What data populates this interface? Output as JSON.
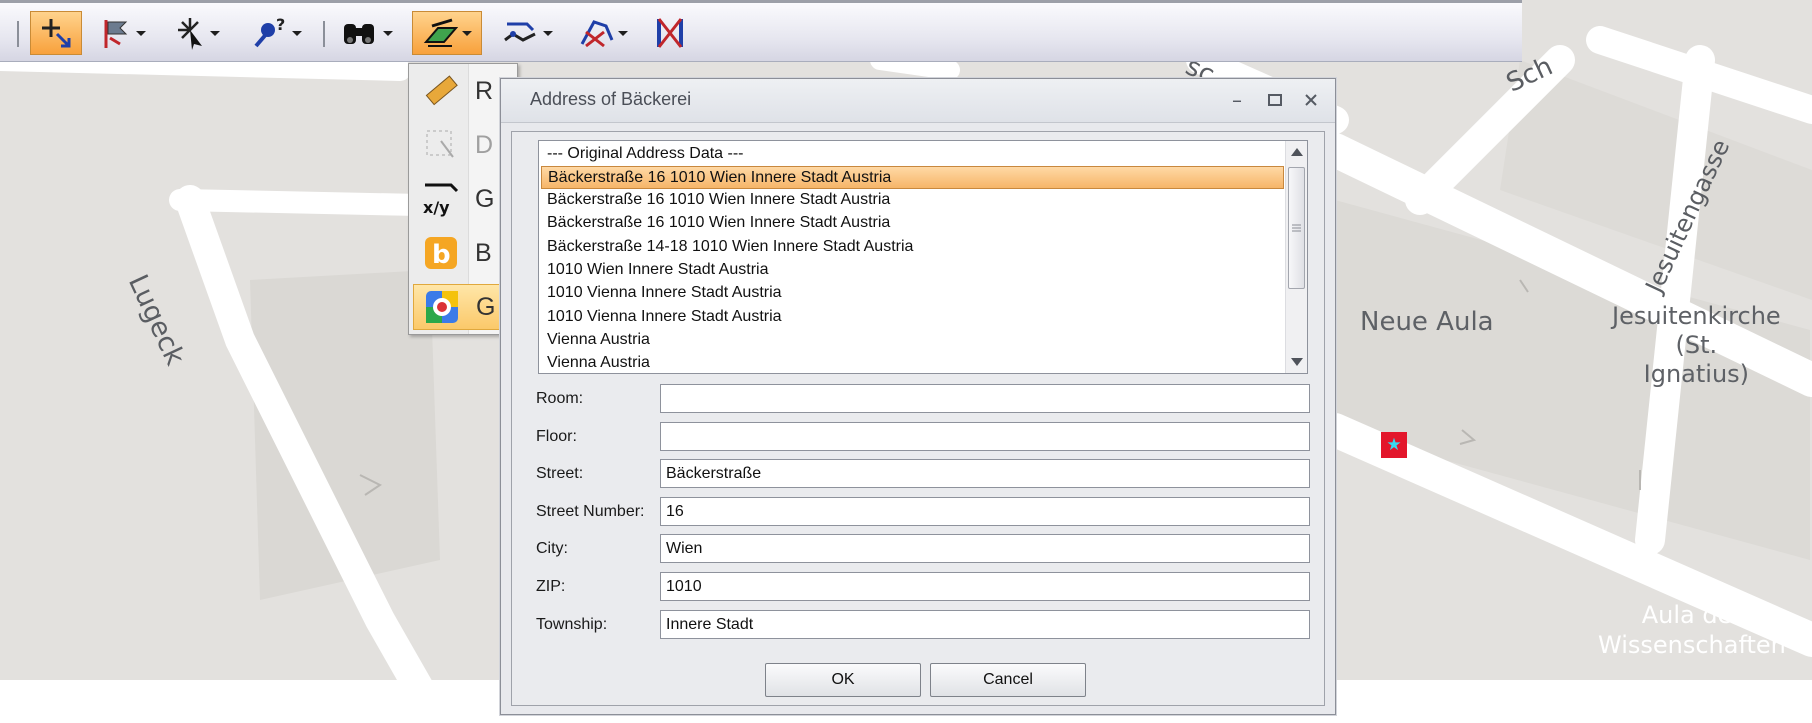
{
  "map": {
    "labels": {
      "lugeck": "Lugeck",
      "jesuitengasse": "Jesuitengasse",
      "neue_aula": "Neue Aula",
      "jesuitenkirche": [
        "Jesuitenkirche",
        "(St.",
        "Ignatius)"
      ],
      "aula": [
        "Aula der",
        "Wissenschaften"
      ],
      "schn_fragment": "Sch",
      "top_fragment": "sc"
    },
    "marker_color": "#e3162b",
    "marker_icon": "star-icon"
  },
  "toolbar": {
    "buttons": [
      {
        "name": "add-point-tool",
        "icon": "crosshair-plus-icon",
        "active": true
      },
      {
        "name": "flag-tool",
        "icon": "flag-icon"
      },
      {
        "name": "select-tool",
        "icon": "sparkle-cursor-icon"
      },
      {
        "name": "query-tool",
        "icon": "pin-question-icon"
      },
      {
        "name": "find-tool",
        "icon": "binoculars-icon"
      },
      {
        "name": "geocode-tool",
        "icon": "geocode-icon",
        "active": true
      },
      {
        "name": "edit-geometry-tool",
        "icon": "edit-line-icon"
      },
      {
        "name": "edit-network-tool",
        "icon": "network-edit-icon"
      },
      {
        "name": "delete-network-tool",
        "icon": "network-delete-icon"
      }
    ]
  },
  "menu": {
    "items": [
      {
        "label": "R",
        "icon": "ruler-icon"
      },
      {
        "label": "D",
        "icon": "dashed-cursor-icon",
        "disabled": true
      },
      {
        "label": "G",
        "icon": "xy-coordinates-icon"
      },
      {
        "label": "B",
        "icon": "bing-icon"
      },
      {
        "label": "G",
        "icon": "google-icon",
        "highlighted": true
      }
    ]
  },
  "dialog": {
    "title": "Address of Bäckerei",
    "list": [
      "--- Original Address Data ---",
      "Bäckerstraße 16 1010 Wien Innere Stadt Austria",
      "Bäckerstraße 16 1010 Wien Innere Stadt Austria",
      "Bäckerstraße 16 1010 Wien Innere Stadt Austria",
      "Bäckerstraße 14-18 1010 Wien Innere Stadt Austria",
      "1010 Wien Innere Stadt Austria",
      "1010 Vienna Innere Stadt Austria",
      "1010 Vienna Innere Stadt Austria",
      "Vienna Austria",
      "Vienna Austria"
    ],
    "selected_index": 1,
    "fields": {
      "room": {
        "label": "Room:",
        "value": ""
      },
      "floor": {
        "label": "Floor:",
        "value": ""
      },
      "street": {
        "label": "Street:",
        "value": "Bäckerstraße"
      },
      "street_number": {
        "label": "Street Number:",
        "value": "16"
      },
      "city": {
        "label": "City:",
        "value": "Wien"
      },
      "zip": {
        "label": "ZIP:",
        "value": "1010"
      },
      "township": {
        "label": "Township:",
        "value": "Innere Stadt"
      }
    },
    "ok_label": "OK",
    "cancel_label": "Cancel"
  },
  "colors": {
    "selection": "#f6b569",
    "map_background": "#e4e2e0",
    "map_road": "#ffffff"
  }
}
